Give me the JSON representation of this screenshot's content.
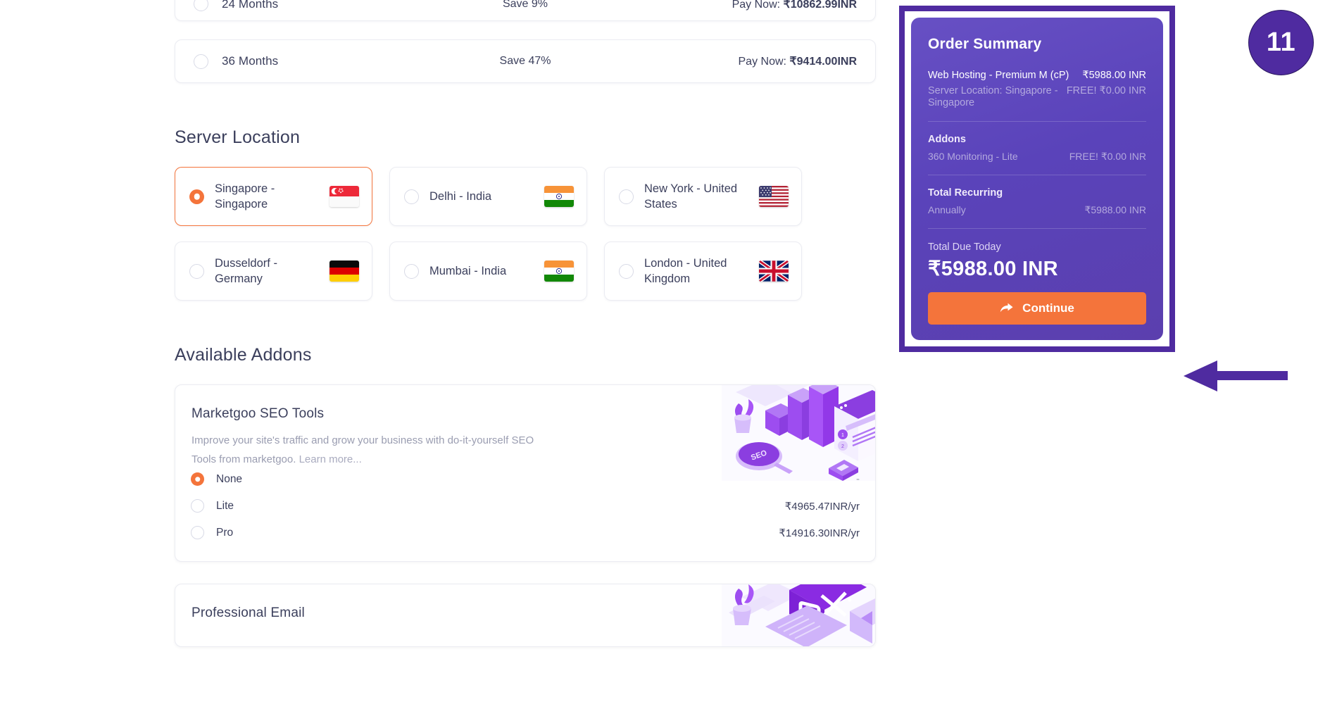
{
  "billing_cycles": [
    {
      "label": "24 Months",
      "save": "Save 9%",
      "pay_prefix": "Pay Now: ",
      "pay_amount": "₹10862.99INR",
      "selected": false
    },
    {
      "label": "36 Months",
      "save": "Save 47%",
      "pay_prefix": "Pay Now: ",
      "pay_amount": "₹9414.00INR",
      "selected": false
    }
  ],
  "server_location": {
    "title": "Server Location",
    "options": [
      {
        "label": "Singapore - Singapore",
        "flag": "flag-singapore",
        "selected": true
      },
      {
        "label": "Delhi - India",
        "flag": "flag-india",
        "selected": false
      },
      {
        "label": "New York - United States",
        "flag": "flag-united-states",
        "selected": false
      },
      {
        "label": "Dusseldorf - Germany",
        "flag": "flag-germany",
        "selected": false
      },
      {
        "label": "Mumbai - India",
        "flag": "flag-india",
        "selected": false
      },
      {
        "label": "London - United Kingdom",
        "flag": "flag-united-kingdom",
        "selected": false
      }
    ]
  },
  "addons": {
    "title": "Available Addons",
    "items": [
      {
        "name": "Marketgoo SEO Tools",
        "description": "Improve your site's traffic and grow your business with do-it-yourself SEO Tools from marketgoo.",
        "learn_more": "Learn more...",
        "illustration": "seo-isometric-illustration",
        "options": [
          {
            "label": "None",
            "price": "-",
            "selected": true
          },
          {
            "label": "Lite",
            "price": "₹4965.47INR/yr",
            "selected": false
          },
          {
            "label": "Pro",
            "price": "₹14916.30INR/yr",
            "selected": false
          }
        ]
      },
      {
        "name": "Professional Email",
        "illustration": "open-xchange-laptop-illustration"
      }
    ]
  },
  "order_summary": {
    "heading": "Order Summary",
    "product": {
      "label": "Web Hosting - Premium M (cP)",
      "price": "₹5988.00 INR"
    },
    "product_sub": {
      "label": "Server Location: Singapore - Singapore",
      "price": "FREE! ₹0.00 INR"
    },
    "addons_title": "Addons",
    "addon_lines": [
      {
        "label": "360 Monitoring - Lite",
        "price": "FREE! ₹0.00 INR"
      }
    ],
    "recurring_title": "Total Recurring",
    "recurring_lines": [
      {
        "label": "Annually",
        "price": "₹5988.00 INR"
      }
    ],
    "total_due_label": "Total Due Today",
    "total_due_value": "₹5988.00 INR",
    "continue_label": "Continue",
    "continue_icon": "forward-arrow-icon"
  },
  "annotation": {
    "step_number": "11",
    "arrow_direction": "left",
    "highlight_target": "order-summary-continue",
    "colors": {
      "annotation_purple": "#4f2ba0",
      "accent_orange": "#f4743b",
      "summary_purple": "#5a43ba"
    }
  }
}
